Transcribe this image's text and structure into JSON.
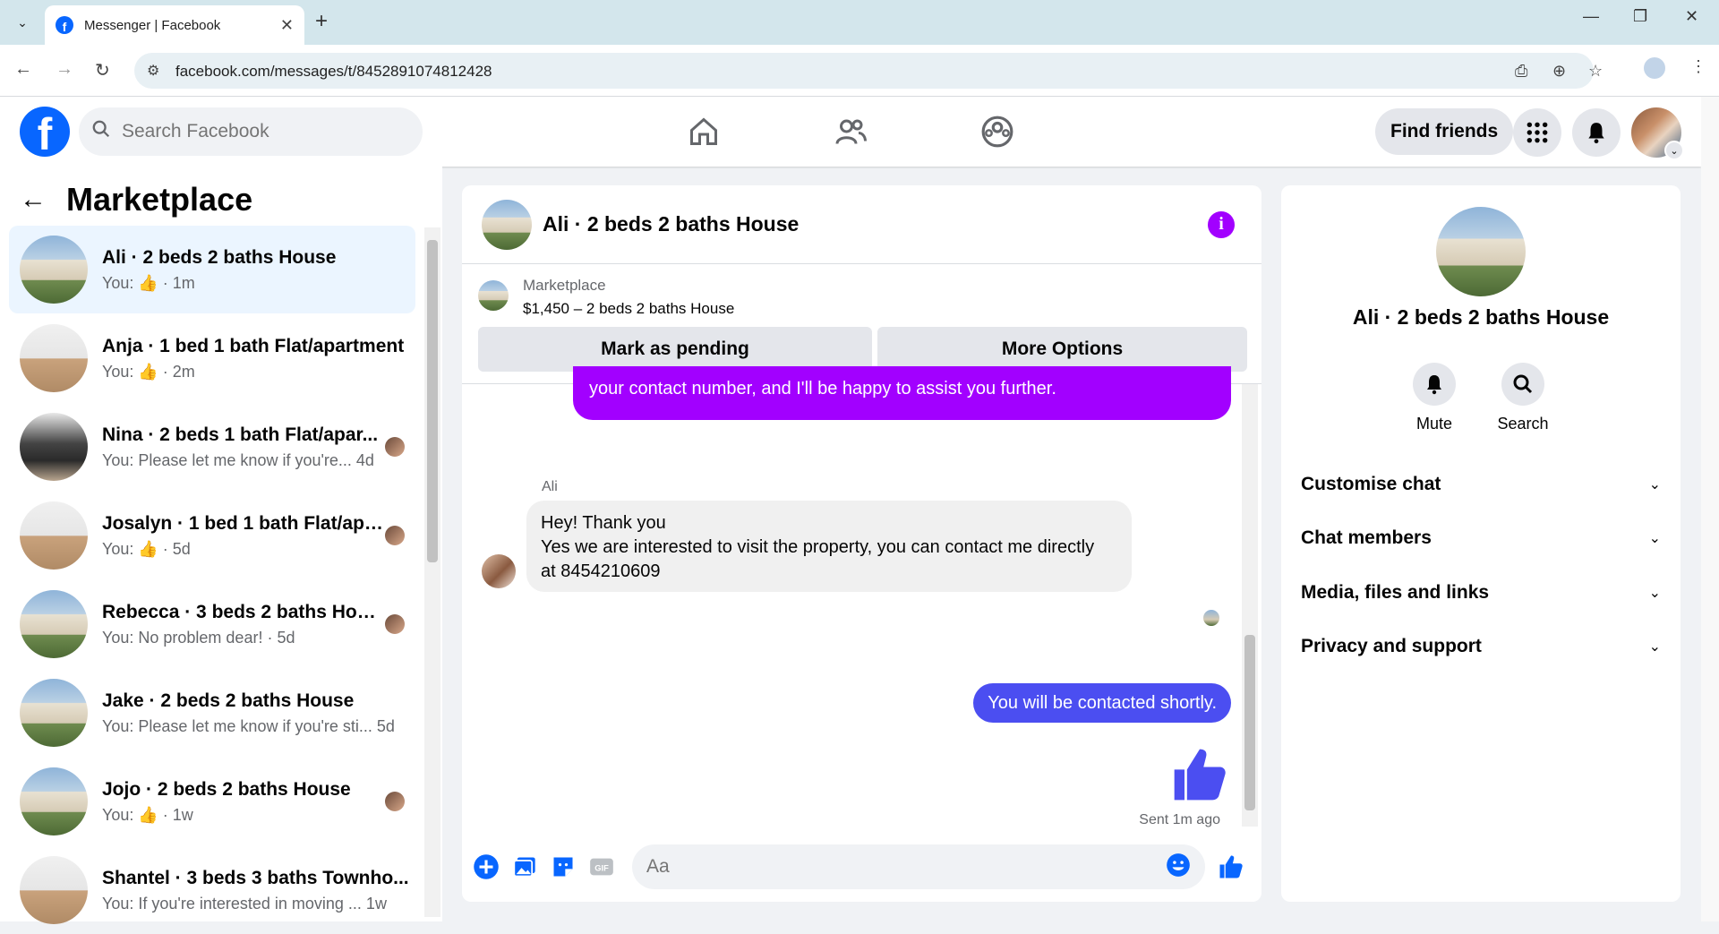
{
  "browser": {
    "tab_title": "Messenger | Facebook",
    "tab_favicon": "f",
    "url": "facebook.com/messages/t/8452891074812428"
  },
  "fb": {
    "logo_letter": "f",
    "search_placeholder": "Search Facebook",
    "find_friends": "Find friends"
  },
  "sidebar": {
    "title": "Marketplace",
    "conversations": [
      {
        "name": "Ali · 2 beds 2 baths House",
        "sub": "You: 👍 · 1m",
        "thumb": "house"
      },
      {
        "name": "Anja · 1 bed 1 bath Flat/apartment",
        "sub": "You: 👍 · 2m",
        "thumb": "interior"
      },
      {
        "name": "Nina · 2 beds 1 bath Flat/apar...",
        "sub": "You: Please let me know if you're... 4d",
        "thumb": "dark"
      },
      {
        "name": "Josalyn · 1 bed 1 bath Flat/apa...",
        "sub": "You: 👍 · 5d",
        "thumb": "interior"
      },
      {
        "name": "Rebecca · 3 beds 2 baths House",
        "sub": "You: No problem dear! · 5d",
        "thumb": "house"
      },
      {
        "name": "Jake · 2 beds 2 baths House",
        "sub": "You: Please let me know if you're sti... 5d",
        "thumb": "house"
      },
      {
        "name": "Jojo · 2 beds 2 baths House",
        "sub": "You: 👍 · 1w",
        "thumb": "house"
      },
      {
        "name": "Shantel · 3 beds 3 baths Townho...",
        "sub": "You: If you're interested in moving ... 1w",
        "thumb": "interior"
      }
    ]
  },
  "chat": {
    "title": "Ali · 2 beds 2 baths House",
    "marketplace_label": "Marketplace",
    "listing": "$1,450 – 2 beds 2 baths House",
    "mark_pending": "Mark as pending",
    "more_options": "More Options",
    "prev_message_tail": "your contact number, and I'll be happy to assist you further.",
    "sender_name": "Ali",
    "incoming_message": "Hey! Thank you\nYes we are interested to visit the property, you can contact me directly at 8454210609",
    "incoming_line1": "Hey! Thank you",
    "incoming_line2": "Yes we are interested to visit the property, you can contact me directly",
    "incoming_line3": "at 8454210609",
    "outgoing_message": "You will be contacted shortly.",
    "sent_status": "Sent 1m ago",
    "composer_placeholder": "Aa"
  },
  "details": {
    "name": "Ali · 2 beds 2 baths House",
    "mute": "Mute",
    "search": "Search",
    "sections": [
      "Customise chat",
      "Chat members",
      "Media, files and links",
      "Privacy and support"
    ]
  },
  "colors": {
    "fb_blue": "#0866ff",
    "purple_bubble": "#a200ff",
    "outgoing_bubble": "#4b4ef1"
  }
}
